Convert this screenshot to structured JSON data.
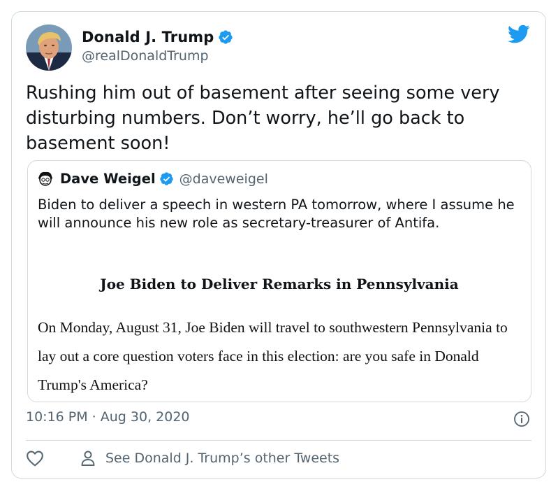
{
  "tweet": {
    "author": {
      "display_name": "Donald J. Trump",
      "handle": "@realDonaldTrump",
      "verified": true,
      "avatar_icon": "trump-avatar"
    },
    "text": "Rushing him out of basement after seeing some very disturbing numbers. Don’t worry, he’ll go back to basement soon!",
    "timestamp": "10:16 PM · Aug 30, 2020",
    "brand_icon": "twitter-bird-icon"
  },
  "quoted_tweet": {
    "author": {
      "display_name": "Dave Weigel",
      "handle": "@daveweigel",
      "verified": true,
      "avatar_icon": "weigel-avatar"
    },
    "text": "Biden to deliver a speech in western PA tomorrow, where I assume he will announce his new role as secretary-treasurer of Antifa.",
    "image": {
      "title": "Joe Biden to Deliver Remarks in Pennsylvania",
      "body": "On Monday, August 31, Joe Biden will travel to southwestern Pennsylvania to lay out a core question voters face in this election: are you safe in Donald Trump's America?"
    }
  },
  "actions": {
    "like_icon": "heart-icon",
    "profile_icon": "person-icon",
    "see_other_tweets": "See Donald J. Trump’s other Tweets"
  },
  "colors": {
    "twitter_blue": "#1d9bf0",
    "text_primary": "#0f1419",
    "text_secondary": "#536471",
    "border": "#cfd9de"
  }
}
